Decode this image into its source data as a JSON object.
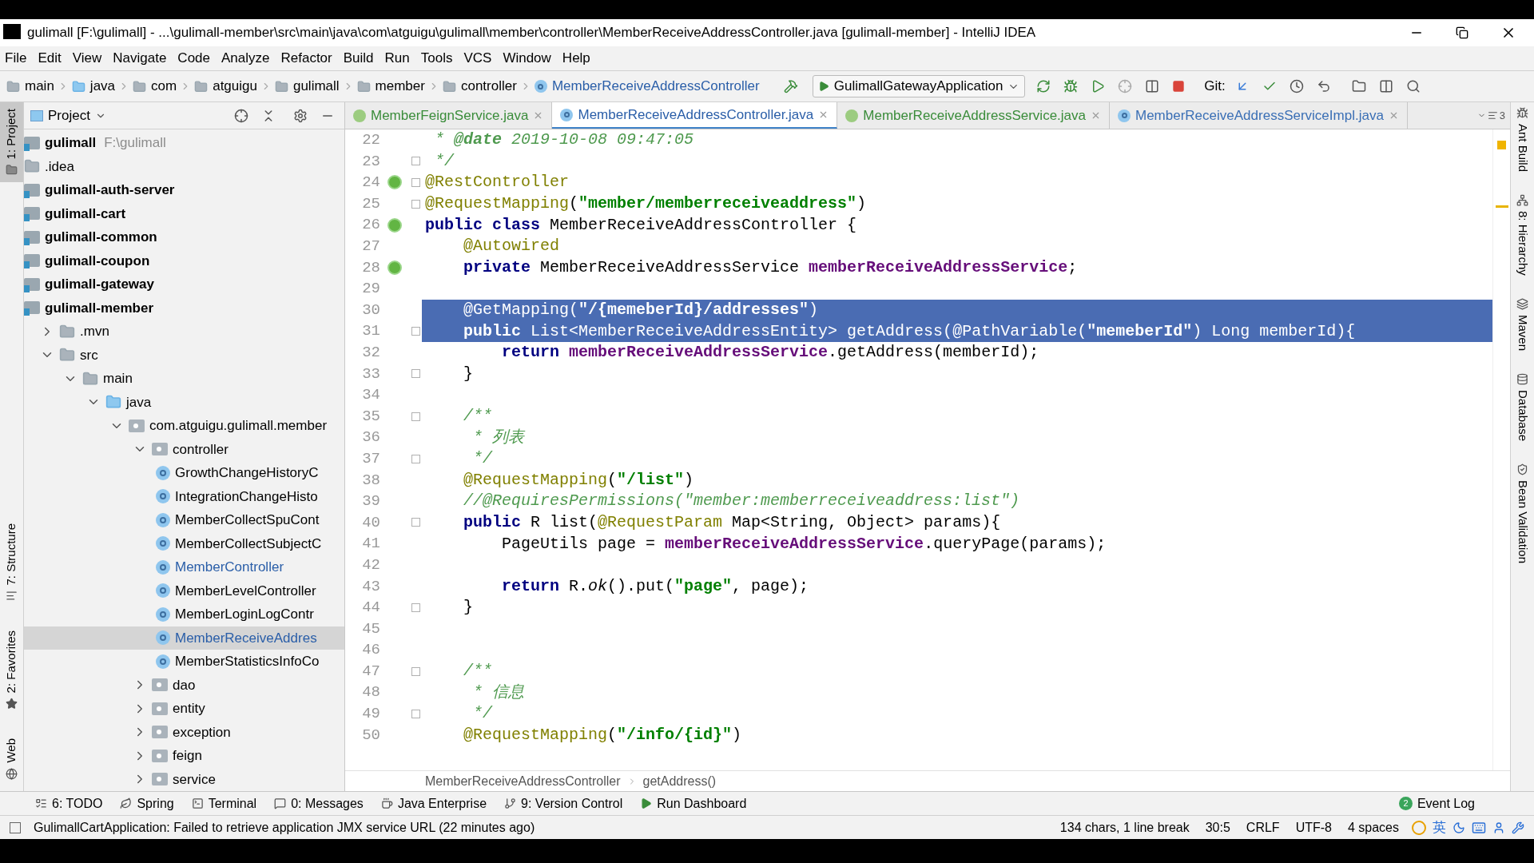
{
  "window": {
    "title": "gulimall [F:\\gulimall] - ...\\gulimall-member\\src\\main\\java\\com\\atguigu\\gulimall\\member\\controller\\MemberReceiveAddressController.java [gulimall-member] - IntelliJ IDEA"
  },
  "menu": [
    "File",
    "Edit",
    "View",
    "Navigate",
    "Code",
    "Analyze",
    "Refactor",
    "Build",
    "Run",
    "Tools",
    "VCS",
    "Window",
    "Help"
  ],
  "navigation": {
    "crumbs": [
      {
        "label": "main",
        "kind": "folder"
      },
      {
        "label": "java",
        "kind": "source-root"
      },
      {
        "label": "com",
        "kind": "folder"
      },
      {
        "label": "atguigu",
        "kind": "folder"
      },
      {
        "label": "gulimall",
        "kind": "folder"
      },
      {
        "label": "member",
        "kind": "folder"
      },
      {
        "label": "controller",
        "kind": "folder"
      },
      {
        "label": "MemberReceiveAddressController",
        "kind": "class"
      }
    ],
    "run_config": "GulimallGatewayApplication",
    "vcs_label": "Git:"
  },
  "left_strip": [
    {
      "label": "1: Project",
      "kind": "project",
      "selected": true
    },
    {
      "label": "7: Structure",
      "kind": "structure",
      "selected": false
    },
    {
      "label": "2: Favorites",
      "kind": "favorites",
      "selected": false
    },
    {
      "label": "Web",
      "kind": "web",
      "selected": false
    }
  ],
  "project_panel": {
    "title": "Project",
    "tree": [
      {
        "label": "gulimall",
        "kind": "project",
        "note": "F:\\gulimall",
        "selected": false,
        "children": [
          {
            "label": ".idea",
            "kind": "folder",
            "selected": false
          },
          {
            "label": "gulimall-auth-server",
            "kind": "module",
            "selected": false
          },
          {
            "label": "gulimall-cart",
            "kind": "module",
            "selected": false
          },
          {
            "label": "gulimall-common",
            "kind": "module",
            "selected": false
          },
          {
            "label": "gulimall-coupon",
            "kind": "module",
            "selected": false
          },
          {
            "label": "gulimall-gateway",
            "kind": "module",
            "selected": false
          },
          {
            "label": "gulimall-member",
            "kind": "module",
            "selected": false,
            "children": [
              {
                "label": ".mvn",
                "kind": "folder",
                "expanded": false,
                "selected": false
              },
              {
                "label": "src",
                "kind": "folder",
                "expanded": true,
                "selected": false,
                "children": [
                  {
                    "label": "main",
                    "kind": "folder",
                    "expanded": true,
                    "selected": false,
                    "children": [
                      {
                        "label": "java",
                        "kind": "source-root",
                        "expanded": true,
                        "selected": false,
                        "children": [
                          {
                            "label": "com.atguigu.gulimall.member",
                            "kind": "package",
                            "expanded": true,
                            "selected": false,
                            "children": [
                              {
                                "label": "controller",
                                "kind": "package",
                                "expanded": true,
                                "selected": false,
                                "children": [
                                  {
                                    "label": "GrowthChangeHistoryC",
                                    "kind": "class",
                                    "modified": false,
                                    "selected": false
                                  },
                                  {
                                    "label": "IntegrationChangeHisto",
                                    "kind": "class",
                                    "modified": false,
                                    "selected": false
                                  },
                                  {
                                    "label": "MemberCollectSpuCont",
                                    "kind": "class",
                                    "modified": false,
                                    "selected": false
                                  },
                                  {
                                    "label": "MemberCollectSubjectC",
                                    "kind": "class",
                                    "modified": false,
                                    "selected": false
                                  },
                                  {
                                    "label": "MemberController",
                                    "kind": "class",
                                    "modified": true,
                                    "selected": false
                                  },
                                  {
                                    "label": "MemberLevelController",
                                    "kind": "class",
                                    "modified": false,
                                    "selected": false
                                  },
                                  {
                                    "label": "MemberLoginLogContr",
                                    "kind": "class",
                                    "modified": false,
                                    "selected": false
                                  },
                                  {
                                    "label": "MemberReceiveAddres",
                                    "kind": "class",
                                    "modified": true,
                                    "selected": true
                                  },
                                  {
                                    "label": "MemberStatisticsInfoCo",
                                    "kind": "class",
                                    "modified": false,
                                    "selected": false
                                  }
                                ]
                              },
                              {
                                "label": "dao",
                                "kind": "package",
                                "expanded": false,
                                "selected": false
                              },
                              {
                                "label": "entity",
                                "kind": "package",
                                "expanded": false,
                                "selected": false
                              },
                              {
                                "label": "exception",
                                "kind": "package",
                                "expanded": false,
                                "selected": false
                              },
                              {
                                "label": "feign",
                                "kind": "package",
                                "expanded": false,
                                "selected": false
                              },
                              {
                                "label": "service",
                                "kind": "package",
                                "expanded": false,
                                "selected": false
                              }
                            ]
                          }
                        ]
                      }
                    ]
                  }
                ]
              }
            ]
          }
        ]
      }
    ]
  },
  "tabs": [
    {
      "label": "MemberFeignService.java",
      "kind": "interface",
      "selected": false
    },
    {
      "label": "MemberReceiveAddressController.java",
      "kind": "class",
      "selected": true
    },
    {
      "label": "MemberReceiveAddressService.java",
      "kind": "interface",
      "selected": false
    },
    {
      "label": "MemberReceiveAddressServiceImpl.java",
      "kind": "class",
      "selected": false
    }
  ],
  "tab_overflow": "3",
  "editor": {
    "lines": [
      {
        "number": "22",
        "selected": false,
        "fold": false,
        "bean": false,
        "tokens": [
          {
            "kind": "comment",
            "text": " * "
          },
          {
            "kind": "doctag",
            "text": "@date"
          },
          {
            "kind": "comment",
            "text": " 2019-10-08 09:47:05"
          }
        ]
      },
      {
        "number": "23",
        "selected": false,
        "fold": true,
        "bean": false,
        "tokens": [
          {
            "kind": "comment",
            "text": " */"
          }
        ]
      },
      {
        "number": "24",
        "selected": false,
        "fold": true,
        "bean": true,
        "tokens": [
          {
            "kind": "ann",
            "text": "@RestController"
          }
        ]
      },
      {
        "number": "25",
        "selected": false,
        "fold": true,
        "bean": false,
        "tokens": [
          {
            "kind": "ann",
            "text": "@RequestMapping"
          },
          {
            "kind": "plain",
            "text": "("
          },
          {
            "kind": "str",
            "text": "\"member/memberreceiveaddress\""
          },
          {
            "kind": "plain",
            "text": ")"
          }
        ]
      },
      {
        "number": "26",
        "selected": false,
        "fold": false,
        "bean": true,
        "tokens": [
          {
            "kind": "kw",
            "text": "public class"
          },
          {
            "kind": "plain",
            "text": " MemberReceiveAddressController {"
          }
        ]
      },
      {
        "number": "27",
        "selected": false,
        "fold": false,
        "bean": false,
        "tokens": [
          {
            "kind": "ann",
            "text": "    @Autowired"
          }
        ]
      },
      {
        "number": "28",
        "selected": false,
        "fold": false,
        "bean": true,
        "tokens": [
          {
            "kind": "kw",
            "text": "    private"
          },
          {
            "kind": "plain",
            "text": " MemberReceiveAddressService "
          },
          {
            "kind": "field",
            "text": "memberReceiveAddressService"
          },
          {
            "kind": "plain",
            "text": ";"
          }
        ]
      },
      {
        "number": "29",
        "selected": false,
        "fold": false,
        "bean": false
      },
      {
        "number": "30",
        "selected": true,
        "fold": false,
        "bean": false,
        "tokens": [
          {
            "kind": "ann",
            "text": "    @GetMapping"
          },
          {
            "kind": "plain",
            "text": "("
          },
          {
            "kind": "str",
            "text": "\"/{memeberId}/addresses\""
          },
          {
            "kind": "plain",
            "text": ")"
          }
        ]
      },
      {
        "number": "31",
        "selected": true,
        "fold": true,
        "bean": false,
        "tokens": [
          {
            "kind": "kw",
            "text": "    public"
          },
          {
            "kind": "plain",
            "text": " List<MemberReceiveAddressEntity> getAddress("
          },
          {
            "kind": "ann",
            "text": "@PathVariable"
          },
          {
            "kind": "plain",
            "text": "("
          },
          {
            "kind": "str",
            "text": "\"memeberId\""
          },
          {
            "kind": "plain",
            "text": ") Long memberId){"
          }
        ]
      },
      {
        "number": "32",
        "selected": false,
        "fold": false,
        "bean": false,
        "tokens": [
          {
            "kind": "kw",
            "text": "        return"
          },
          {
            "kind": "field",
            "text": " memberReceiveAddressService"
          },
          {
            "kind": "plain",
            "text": ".getAddress(memberId);"
          }
        ]
      },
      {
        "number": "33",
        "selected": false,
        "fold": true,
        "bean": false,
        "tokens": [
          {
            "kind": "plain",
            "text": "    }"
          }
        ]
      },
      {
        "number": "34",
        "selected": false,
        "fold": false,
        "bean": false
      },
      {
        "number": "35",
        "selected": false,
        "fold": true,
        "bean": false,
        "tokens": [
          {
            "kind": "comment",
            "text": "    /**"
          }
        ]
      },
      {
        "number": "36",
        "selected": false,
        "fold": false,
        "bean": false,
        "tokens": [
          {
            "kind": "comment",
            "text": "     * 列表"
          }
        ]
      },
      {
        "number": "37",
        "selected": false,
        "fold": true,
        "bean": false,
        "tokens": [
          {
            "kind": "comment",
            "text": "     */"
          }
        ]
      },
      {
        "number": "38",
        "selected": false,
        "fold": false,
        "bean": false,
        "tokens": [
          {
            "kind": "ann",
            "text": "    @RequestMapping"
          },
          {
            "kind": "plain",
            "text": "("
          },
          {
            "kind": "str",
            "text": "\"/list\""
          },
          {
            "kind": "plain",
            "text": ")"
          }
        ]
      },
      {
        "number": "39",
        "selected": false,
        "fold": false,
        "bean": false,
        "tokens": [
          {
            "kind": "comment",
            "text": "    //@RequiresPermissions(\"member:memberreceiveaddress:list\")"
          }
        ]
      },
      {
        "number": "40",
        "selected": false,
        "fold": true,
        "bean": false,
        "tokens": [
          {
            "kind": "kw",
            "text": "    public"
          },
          {
            "kind": "plain",
            "text": " R list("
          },
          {
            "kind": "ann",
            "text": "@RequestParam"
          },
          {
            "kind": "plain",
            "text": " Map<String, Object> params){"
          }
        ]
      },
      {
        "number": "41",
        "selected": false,
        "fold": false,
        "bean": false,
        "tokens": [
          {
            "kind": "plain",
            "text": "        PageUtils page = "
          },
          {
            "kind": "field",
            "text": "memberReceiveAddressService"
          },
          {
            "kind": "plain",
            "text": ".queryPage(params);"
          }
        ]
      },
      {
        "number": "42",
        "selected": false,
        "fold": false,
        "bean": false
      },
      {
        "number": "43",
        "selected": false,
        "fold": false,
        "bean": false,
        "tokens": [
          {
            "kind": "kw",
            "text": "        return"
          },
          {
            "kind": "plain",
            "text": " R."
          },
          {
            "kind": "static",
            "text": "ok"
          },
          {
            "kind": "plain",
            "text": "().put("
          },
          {
            "kind": "str",
            "text": "\"page\""
          },
          {
            "kind": "plain",
            "text": ", page);"
          }
        ]
      },
      {
        "number": "44",
        "selected": false,
        "fold": true,
        "bean": false,
        "tokens": [
          {
            "kind": "plain",
            "text": "    }"
          }
        ]
      },
      {
        "number": "45",
        "selected": false,
        "fold": false,
        "bean": false
      },
      {
        "number": "46",
        "selected": false,
        "fold": false,
        "bean": false
      },
      {
        "number": "47",
        "selected": false,
        "fold": true,
        "bean": false,
        "tokens": [
          {
            "kind": "comment",
            "text": "    /**"
          }
        ]
      },
      {
        "number": "48",
        "selected": false,
        "fold": false,
        "bean": false,
        "tokens": [
          {
            "kind": "comment",
            "text": "     * 信息"
          }
        ]
      },
      {
        "number": "49",
        "selected": false,
        "fold": true,
        "bean": false,
        "tokens": [
          {
            "kind": "comment",
            "text": "     */"
          }
        ]
      },
      {
        "number": "50",
        "selected": false,
        "fold": false,
        "bean": false,
        "tokens": [
          {
            "kind": "ann",
            "text": "    @RequestMapping"
          },
          {
            "kind": "plain",
            "text": "("
          },
          {
            "kind": "str",
            "text": "\"/info/{id}\""
          },
          {
            "kind": "plain",
            "text": ")"
          }
        ]
      }
    ],
    "breadcrumb": [
      "MemberReceiveAddressController",
      "getAddress()"
    ]
  },
  "right_strip": [
    {
      "label": "Ant Build",
      "kind": "ant"
    },
    {
      "label": "8: Hierarchy",
      "kind": "hierarchy"
    },
    {
      "label": "Maven",
      "kind": "maven"
    },
    {
      "label": "Database",
      "kind": "database"
    },
    {
      "label": "Bean Validation",
      "kind": "bean"
    }
  ],
  "tool_tabs": [
    {
      "label": "6: TODO",
      "kind": "todo"
    },
    {
      "label": "Spring",
      "kind": "spring"
    },
    {
      "label": "Terminal",
      "kind": "terminal"
    },
    {
      "label": "0: Messages",
      "kind": "messages"
    },
    {
      "label": "Java Enterprise",
      "kind": "enterprise"
    },
    {
      "label": "9: Version Control",
      "kind": "vcs"
    },
    {
      "label": "Run Dashboard",
      "kind": "run"
    }
  ],
  "event_log": {
    "label": "Event Log",
    "count": "2"
  },
  "status_bar": {
    "message": "GulimallCartApplication: Failed to retrieve application JMX service URL (22 minutes ago)",
    "items": [
      "134 chars, 1 line break",
      "30:5",
      "CRLF",
      "UTF-8",
      "4 spaces"
    ],
    "ime": "英"
  }
}
